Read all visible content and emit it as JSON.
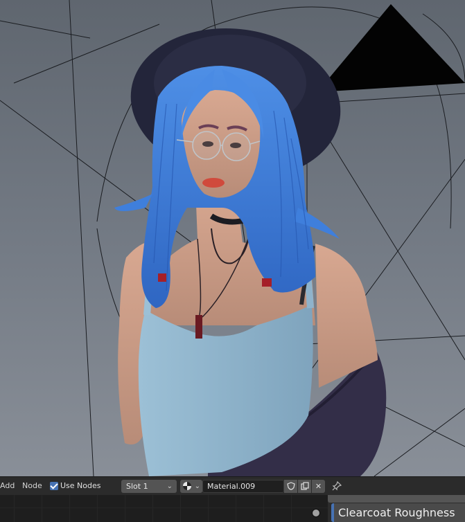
{
  "node_editor_header": {
    "add_label": "Add",
    "node_label": "Node",
    "use_nodes_label": "Use Nodes",
    "use_nodes_checked": true,
    "slot_value": "Slot 1",
    "material_name": "Material.009"
  },
  "node_editor": {
    "field_label": "Clearcoat Roughness"
  },
  "icons": {
    "material_browse": "material-sphere-icon",
    "fake_user": "shield-icon",
    "duplicate": "duplicate-icon",
    "unlink": "close-icon",
    "pin": "pin-icon"
  },
  "colors": {
    "accent": "#4772b3",
    "header_bg": "#2b2b2b",
    "hair": "#3b7ad6",
    "hat": "#23253a",
    "top": "#8fb4cb",
    "jacket": "#322d48"
  }
}
